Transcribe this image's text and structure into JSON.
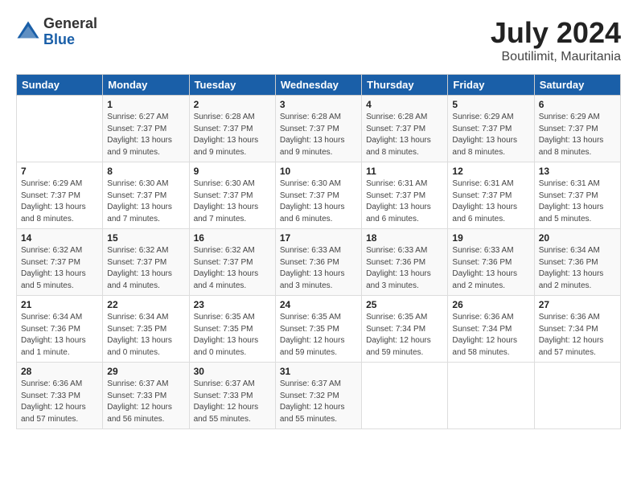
{
  "header": {
    "logo_general": "General",
    "logo_blue": "Blue",
    "month_year": "July 2024",
    "location": "Boutilimit, Mauritania"
  },
  "days_of_week": [
    "Sunday",
    "Monday",
    "Tuesday",
    "Wednesday",
    "Thursday",
    "Friday",
    "Saturday"
  ],
  "weeks": [
    [
      {
        "num": "",
        "info": ""
      },
      {
        "num": "1",
        "info": "Sunrise: 6:27 AM\nSunset: 7:37 PM\nDaylight: 13 hours\nand 9 minutes."
      },
      {
        "num": "2",
        "info": "Sunrise: 6:28 AM\nSunset: 7:37 PM\nDaylight: 13 hours\nand 9 minutes."
      },
      {
        "num": "3",
        "info": "Sunrise: 6:28 AM\nSunset: 7:37 PM\nDaylight: 13 hours\nand 9 minutes."
      },
      {
        "num": "4",
        "info": "Sunrise: 6:28 AM\nSunset: 7:37 PM\nDaylight: 13 hours\nand 8 minutes."
      },
      {
        "num": "5",
        "info": "Sunrise: 6:29 AM\nSunset: 7:37 PM\nDaylight: 13 hours\nand 8 minutes."
      },
      {
        "num": "6",
        "info": "Sunrise: 6:29 AM\nSunset: 7:37 PM\nDaylight: 13 hours\nand 8 minutes."
      }
    ],
    [
      {
        "num": "7",
        "info": "Sunrise: 6:29 AM\nSunset: 7:37 PM\nDaylight: 13 hours\nand 8 minutes."
      },
      {
        "num": "8",
        "info": "Sunrise: 6:30 AM\nSunset: 7:37 PM\nDaylight: 13 hours\nand 7 minutes."
      },
      {
        "num": "9",
        "info": "Sunrise: 6:30 AM\nSunset: 7:37 PM\nDaylight: 13 hours\nand 7 minutes."
      },
      {
        "num": "10",
        "info": "Sunrise: 6:30 AM\nSunset: 7:37 PM\nDaylight: 13 hours\nand 6 minutes."
      },
      {
        "num": "11",
        "info": "Sunrise: 6:31 AM\nSunset: 7:37 PM\nDaylight: 13 hours\nand 6 minutes."
      },
      {
        "num": "12",
        "info": "Sunrise: 6:31 AM\nSunset: 7:37 PM\nDaylight: 13 hours\nand 6 minutes."
      },
      {
        "num": "13",
        "info": "Sunrise: 6:31 AM\nSunset: 7:37 PM\nDaylight: 13 hours\nand 5 minutes."
      }
    ],
    [
      {
        "num": "14",
        "info": "Sunrise: 6:32 AM\nSunset: 7:37 PM\nDaylight: 13 hours\nand 5 minutes."
      },
      {
        "num": "15",
        "info": "Sunrise: 6:32 AM\nSunset: 7:37 PM\nDaylight: 13 hours\nand 4 minutes."
      },
      {
        "num": "16",
        "info": "Sunrise: 6:32 AM\nSunset: 7:37 PM\nDaylight: 13 hours\nand 4 minutes."
      },
      {
        "num": "17",
        "info": "Sunrise: 6:33 AM\nSunset: 7:36 PM\nDaylight: 13 hours\nand 3 minutes."
      },
      {
        "num": "18",
        "info": "Sunrise: 6:33 AM\nSunset: 7:36 PM\nDaylight: 13 hours\nand 3 minutes."
      },
      {
        "num": "19",
        "info": "Sunrise: 6:33 AM\nSunset: 7:36 PM\nDaylight: 13 hours\nand 2 minutes."
      },
      {
        "num": "20",
        "info": "Sunrise: 6:34 AM\nSunset: 7:36 PM\nDaylight: 13 hours\nand 2 minutes."
      }
    ],
    [
      {
        "num": "21",
        "info": "Sunrise: 6:34 AM\nSunset: 7:36 PM\nDaylight: 13 hours\nand 1 minute."
      },
      {
        "num": "22",
        "info": "Sunrise: 6:34 AM\nSunset: 7:35 PM\nDaylight: 13 hours\nand 0 minutes."
      },
      {
        "num": "23",
        "info": "Sunrise: 6:35 AM\nSunset: 7:35 PM\nDaylight: 13 hours\nand 0 minutes."
      },
      {
        "num": "24",
        "info": "Sunrise: 6:35 AM\nSunset: 7:35 PM\nDaylight: 12 hours\nand 59 minutes."
      },
      {
        "num": "25",
        "info": "Sunrise: 6:35 AM\nSunset: 7:34 PM\nDaylight: 12 hours\nand 59 minutes."
      },
      {
        "num": "26",
        "info": "Sunrise: 6:36 AM\nSunset: 7:34 PM\nDaylight: 12 hours\nand 58 minutes."
      },
      {
        "num": "27",
        "info": "Sunrise: 6:36 AM\nSunset: 7:34 PM\nDaylight: 12 hours\nand 57 minutes."
      }
    ],
    [
      {
        "num": "28",
        "info": "Sunrise: 6:36 AM\nSunset: 7:33 PM\nDaylight: 12 hours\nand 57 minutes."
      },
      {
        "num": "29",
        "info": "Sunrise: 6:37 AM\nSunset: 7:33 PM\nDaylight: 12 hours\nand 56 minutes."
      },
      {
        "num": "30",
        "info": "Sunrise: 6:37 AM\nSunset: 7:33 PM\nDaylight: 12 hours\nand 55 minutes."
      },
      {
        "num": "31",
        "info": "Sunrise: 6:37 AM\nSunset: 7:32 PM\nDaylight: 12 hours\nand 55 minutes."
      },
      {
        "num": "",
        "info": ""
      },
      {
        "num": "",
        "info": ""
      },
      {
        "num": "",
        "info": ""
      }
    ]
  ]
}
